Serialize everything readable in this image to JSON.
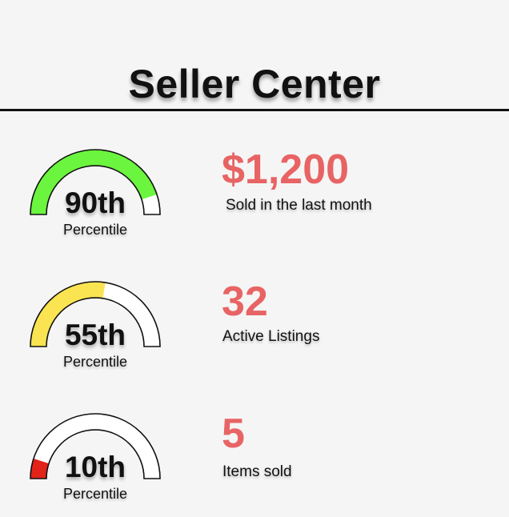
{
  "header": {
    "title": "Seller Center"
  },
  "stats": [
    {
      "gauge_label": "90th",
      "gauge_sub": "Percentile",
      "percentile": 90,
      "fill_color": "#6cf53e",
      "value": "$1,200",
      "label": "Sold in the last month"
    },
    {
      "gauge_label": "55th",
      "gauge_sub": "Percentile",
      "percentile": 55,
      "fill_color": "#fae451",
      "value": "32",
      "label": "Active Listings"
    },
    {
      "gauge_label": "10th",
      "gauge_sub": "Percentile",
      "percentile": 10,
      "fill_color": "#e2231a",
      "value": "5",
      "label": "Items sold"
    }
  ],
  "colors": {
    "accent": "#e86464",
    "track": "#ffffff",
    "outline": "#111111",
    "background": "#f5f5f5"
  }
}
